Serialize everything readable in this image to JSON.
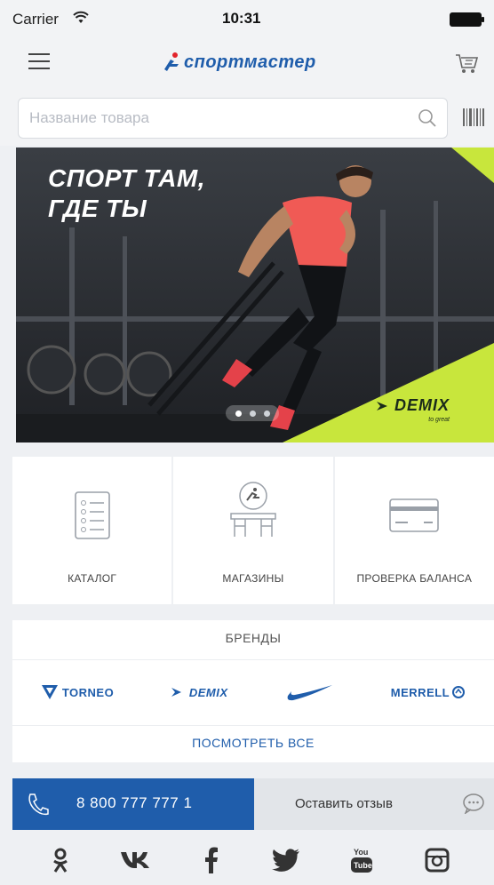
{
  "status_bar": {
    "carrier": "Carrier",
    "time": "10:31"
  },
  "nav": {
    "logo_text": "спортмастер",
    "icons": [
      "menu-icon",
      "cart-icon"
    ]
  },
  "search": {
    "placeholder": "Название товара",
    "icons": [
      "search-icon",
      "barcode-icon"
    ]
  },
  "banner": {
    "headline_line1": "СПОРТ ТАМ,",
    "headline_line2": "ГДЕ ТЫ",
    "brand_name": "DEMIX",
    "brand_sub": "to great",
    "slides_count": 3,
    "active_slide": 1
  },
  "quick_links": [
    {
      "label": "КАТАЛОГ",
      "icon": "catalog-icon"
    },
    {
      "label": "МАГАЗИНЫ",
      "icon": "stores-icon"
    },
    {
      "label": "ПРОВЕРКА БАЛАНСА",
      "icon": "card-icon"
    }
  ],
  "brands": {
    "title": "БРЕНДЫ",
    "items": [
      "TORNEO",
      "DEMIX",
      "NIKE",
      "MERRELL"
    ],
    "see_all": "ПОСМОТРЕТЬ ВСЕ"
  },
  "contact": {
    "phone": "8 800 777 777 1",
    "feedback_label": "Оставить отзыв"
  },
  "social": [
    "odnoklassniki-icon",
    "vk-icon",
    "facebook-icon",
    "twitter-icon",
    "youtube-icon",
    "instagram-icon"
  ],
  "colors": {
    "brand_blue": "#1f5dab",
    "banner_accent": "#c8e63c",
    "background": "#eef0f3"
  }
}
